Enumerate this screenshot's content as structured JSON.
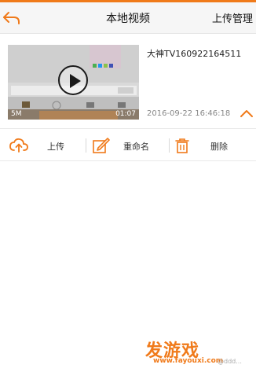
{
  "header": {
    "title": "本地视频",
    "upload_manage": "上传管理"
  },
  "video": {
    "name": "大神TV160922164511",
    "date": "2016-09-22 16:46:18",
    "size": "5M",
    "duration": "01:07"
  },
  "actions": {
    "upload": "上传",
    "rename": "重命名",
    "delete": "删除"
  },
  "watermark": {
    "logo": "发游戏",
    "url": "www.fayouxi.com",
    "extra": "@ddd..."
  },
  "colors": {
    "accent": "#f07a1a"
  }
}
